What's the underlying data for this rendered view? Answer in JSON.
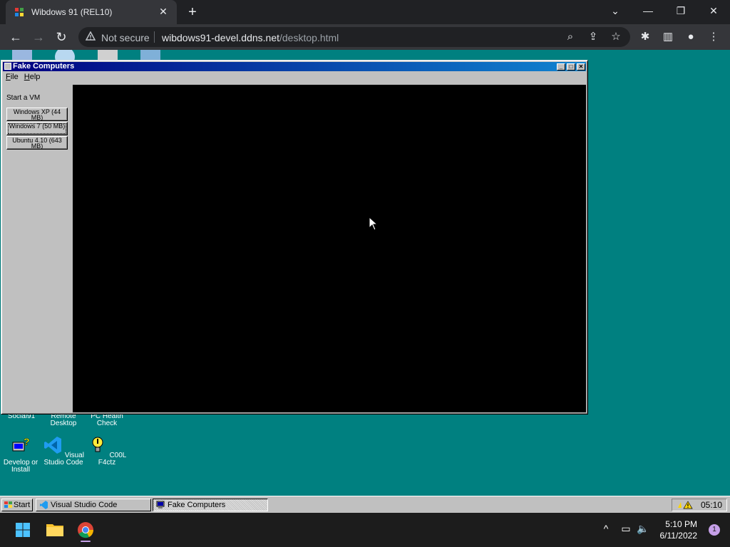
{
  "browser": {
    "tab_title": "Wibdows 91 (REL10)",
    "not_secure": "Not secure",
    "url_host": "wibdows91-devel.ddns.net",
    "url_path": "/desktop.html",
    "tab_close": "✕",
    "new_tab": "+",
    "window_controls": {
      "dropdown": "⌄",
      "minimize": "—",
      "restore": "❐",
      "close": "✕"
    },
    "nav": {
      "back": "←",
      "forward": "→",
      "reload": "↻"
    }
  },
  "desktop_icons": [
    {
      "label": "Social91"
    },
    {
      "label": "Remote Desktop"
    },
    {
      "label": "PC Health Check"
    },
    {
      "label": "Develop or Install"
    },
    {
      "label": "Visual Studio Code"
    },
    {
      "label": "C00L F4ctz"
    }
  ],
  "fake_computers": {
    "title": "Fake Computers",
    "menu": [
      "File",
      "Help"
    ],
    "sidebar_label": "Start a VM",
    "vms": [
      {
        "label": "Windows XP (44 MB)"
      },
      {
        "label": "Windows 7 (50 MB)"
      },
      {
        "label": "Ubuntu 4.10 (643 MB)"
      }
    ]
  },
  "w91_taskbar": {
    "start": "Start",
    "tasks": [
      {
        "label": "Visual Studio Code"
      },
      {
        "label": "Fake Computers"
      }
    ],
    "clock": "05:10"
  },
  "windows_taskbar": {
    "time": "5:10 PM",
    "date": "6/11/2022",
    "notification_count": "1",
    "tray_chevron": "^"
  },
  "colors": {
    "desktop": "#008080",
    "titlebar_start": "#000080",
    "titlebar_end": "#1084d0"
  }
}
